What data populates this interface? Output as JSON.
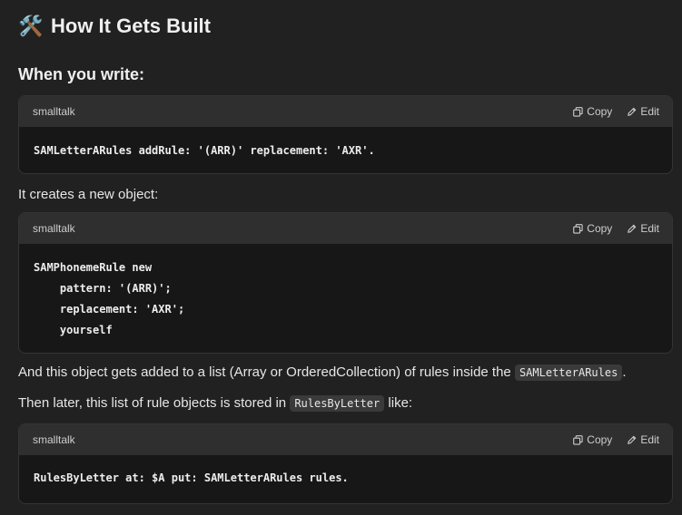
{
  "heading": {
    "emoji": "🛠️",
    "title": "How It Gets Built"
  },
  "subheading": "When you write:",
  "blocks": [
    {
      "language": "smalltalk",
      "copy_label": "Copy",
      "edit_label": "Edit",
      "code": "SAMLetterARules addRule: '(ARR)' replacement: 'AXR'."
    },
    {
      "language": "smalltalk",
      "copy_label": "Copy",
      "edit_label": "Edit",
      "code": "SAMPhonemeRule new\n    pattern: '(ARR)';\n    replacement: 'AXR';\n    yourself"
    },
    {
      "language": "smalltalk",
      "copy_label": "Copy",
      "edit_label": "Edit",
      "code": "RulesByLetter at: $A put: SAMLetterARules rules."
    }
  ],
  "para1": "It creates a new object:",
  "para2": {
    "text_before": "And this object gets added to a list (Array or OrderedCollection) of rules inside the ",
    "code": "SAMLetterARules",
    "text_after": "."
  },
  "para3": {
    "text_before": "Then later, this list of rule objects is stored in ",
    "code": "RulesByLetter",
    "text_after": " like:"
  }
}
